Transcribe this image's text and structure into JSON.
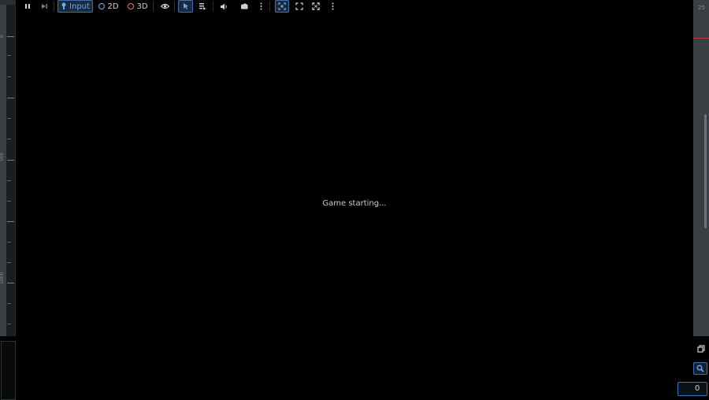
{
  "toolbar": {
    "input_label": "Input",
    "mode_2d_label": "2D",
    "mode_3d_label": "3D"
  },
  "viewport": {
    "status_text": "Game starting..."
  },
  "ruler": {
    "marks": [
      "0",
      "500",
      "1000"
    ]
  },
  "right_panel": {
    "corner_number": "25",
    "field_value": "0"
  },
  "colors": {
    "background": "#000000",
    "accent": "#3c6fb4",
    "input_text": "#6ea6ec",
    "circle_2d": "#7fb0ee",
    "circle_3d": "#ea7979"
  }
}
